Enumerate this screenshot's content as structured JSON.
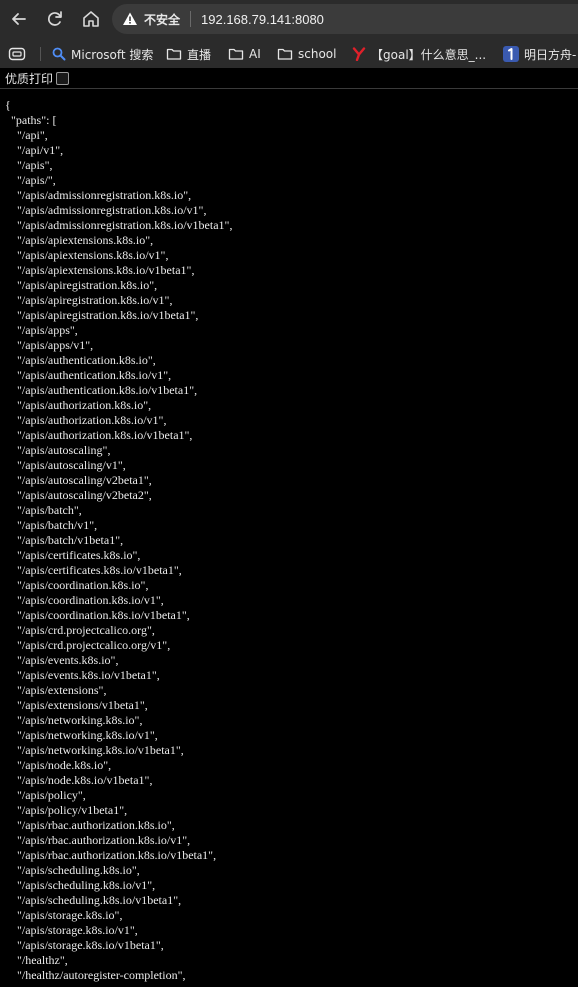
{
  "address_bar": {
    "security_label": "不安全",
    "url": "192.168.79.141:8080"
  },
  "bookmarks": [
    {
      "label": "Microsoft 搜索",
      "icon": "search-icon"
    },
    {
      "label": "直播",
      "icon": "folder-icon"
    },
    {
      "label": "AI",
      "icon": "folder-icon"
    },
    {
      "label": "school",
      "icon": "folder-icon"
    },
    {
      "label": "【goal】什么意思_...",
      "icon": "y-logo-icon"
    },
    {
      "label": "明日方舟-",
      "icon": "number-one-icon"
    }
  ],
  "pretty_print": {
    "label": "优质打印"
  },
  "json_lines": [
    "{",
    "  \"paths\": [",
    "    \"/api\",",
    "    \"/api/v1\",",
    "    \"/apis\",",
    "    \"/apis/\",",
    "    \"/apis/admissionregistration.k8s.io\",",
    "    \"/apis/admissionregistration.k8s.io/v1\",",
    "    \"/apis/admissionregistration.k8s.io/v1beta1\",",
    "    \"/apis/apiextensions.k8s.io\",",
    "    \"/apis/apiextensions.k8s.io/v1\",",
    "    \"/apis/apiextensions.k8s.io/v1beta1\",",
    "    \"/apis/apiregistration.k8s.io\",",
    "    \"/apis/apiregistration.k8s.io/v1\",",
    "    \"/apis/apiregistration.k8s.io/v1beta1\",",
    "    \"/apis/apps\",",
    "    \"/apis/apps/v1\",",
    "    \"/apis/authentication.k8s.io\",",
    "    \"/apis/authentication.k8s.io/v1\",",
    "    \"/apis/authentication.k8s.io/v1beta1\",",
    "    \"/apis/authorization.k8s.io\",",
    "    \"/apis/authorization.k8s.io/v1\",",
    "    \"/apis/authorization.k8s.io/v1beta1\",",
    "    \"/apis/autoscaling\",",
    "    \"/apis/autoscaling/v1\",",
    "    \"/apis/autoscaling/v2beta1\",",
    "    \"/apis/autoscaling/v2beta2\",",
    "    \"/apis/batch\",",
    "    \"/apis/batch/v1\",",
    "    \"/apis/batch/v1beta1\",",
    "    \"/apis/certificates.k8s.io\",",
    "    \"/apis/certificates.k8s.io/v1beta1\",",
    "    \"/apis/coordination.k8s.io\",",
    "    \"/apis/coordination.k8s.io/v1\",",
    "    \"/apis/coordination.k8s.io/v1beta1\",",
    "    \"/apis/crd.projectcalico.org\",",
    "    \"/apis/crd.projectcalico.org/v1\",",
    "    \"/apis/events.k8s.io\",",
    "    \"/apis/events.k8s.io/v1beta1\",",
    "    \"/apis/extensions\",",
    "    \"/apis/extensions/v1beta1\",",
    "    \"/apis/networking.k8s.io\",",
    "    \"/apis/networking.k8s.io/v1\",",
    "    \"/apis/networking.k8s.io/v1beta1\",",
    "    \"/apis/node.k8s.io\",",
    "    \"/apis/node.k8s.io/v1beta1\",",
    "    \"/apis/policy\",",
    "    \"/apis/policy/v1beta1\",",
    "    \"/apis/rbac.authorization.k8s.io\",",
    "    \"/apis/rbac.authorization.k8s.io/v1\",",
    "    \"/apis/rbac.authorization.k8s.io/v1beta1\",",
    "    \"/apis/scheduling.k8s.io\",",
    "    \"/apis/scheduling.k8s.io/v1\",",
    "    \"/apis/scheduling.k8s.io/v1beta1\",",
    "    \"/apis/storage.k8s.io\",",
    "    \"/apis/storage.k8s.io/v1\",",
    "    \"/apis/storage.k8s.io/v1beta1\",",
    "    \"/healthz\",",
    "    \"/healthz/autoregister-completion\","
  ],
  "colors": {
    "background": "#000000",
    "chrome": "#2b2b2b",
    "text": "#ececec",
    "warning": "#ffffff"
  }
}
